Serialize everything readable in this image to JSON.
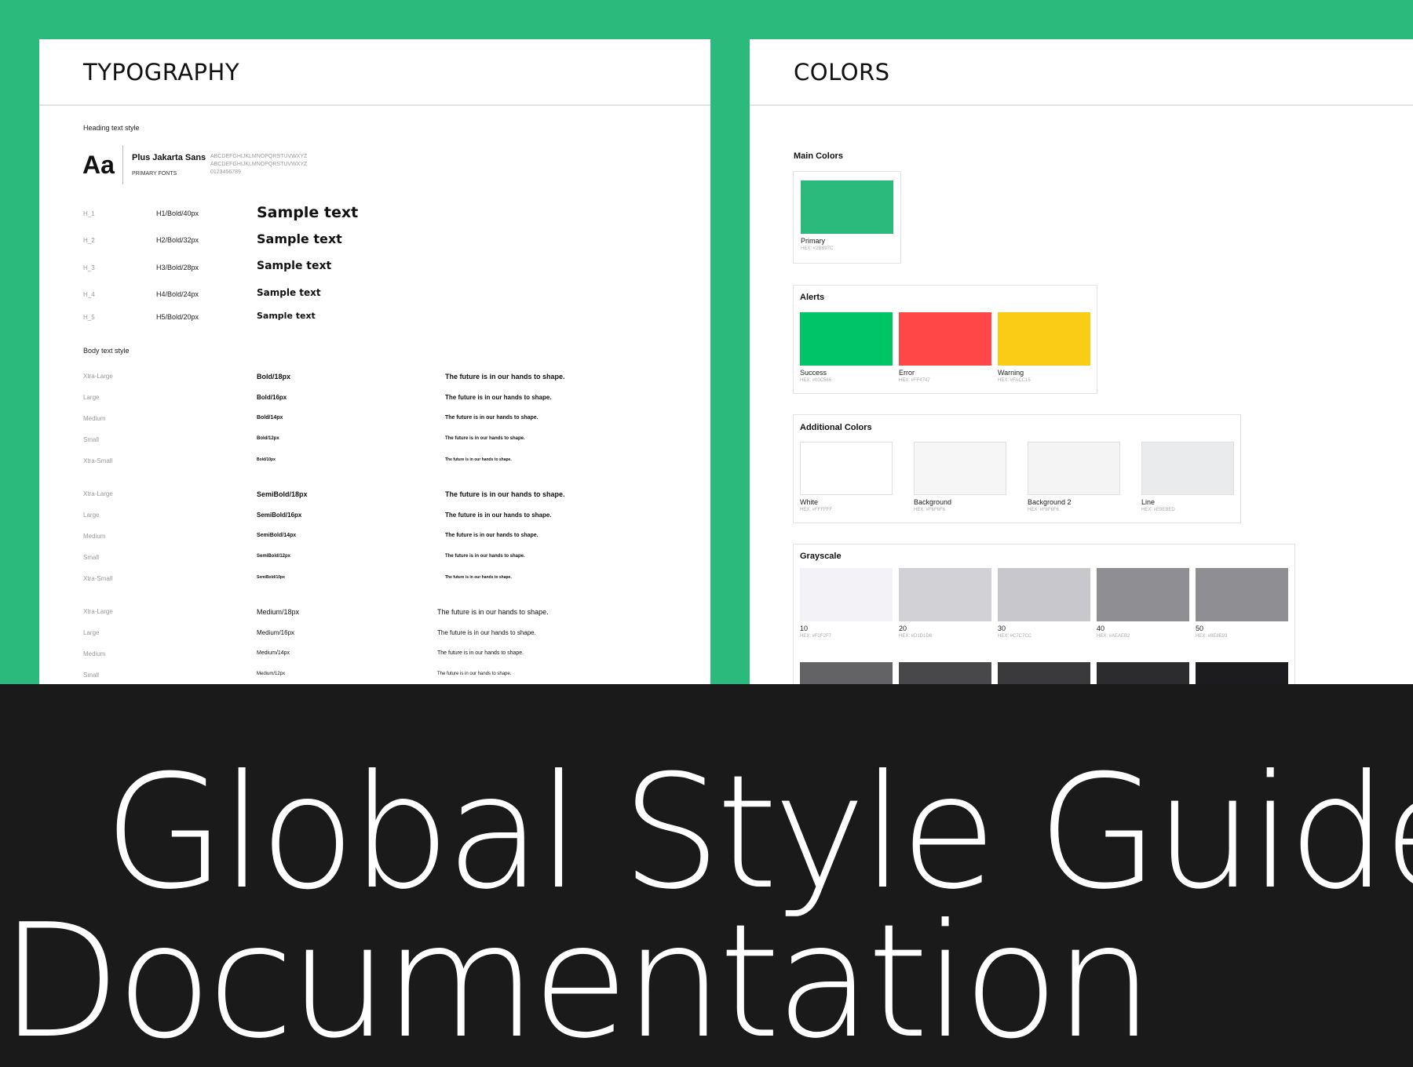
{
  "typography": {
    "title": "TYPOGRAPHY",
    "heading_section_label": "Heading text style",
    "font_sample": "Aa",
    "font_name": "Plus Jakarta Sans",
    "font_role": "PRIMARY FONTS",
    "alphabet_upper": "ABCDEFGHIJKLMNOPQRSTUVWXYZ",
    "alphabet_lower": "ABCDEFGHIJKLMNOPQRSTUVWXYZ",
    "digits": "0123456789",
    "headings": [
      {
        "key": "H_1",
        "spec": "H1/Bold/40px",
        "sample": "Sample text"
      },
      {
        "key": "H_2",
        "spec": "H2/Bold/32px",
        "sample": "Sample text"
      },
      {
        "key": "H_3",
        "spec": "H3/Bold/28px",
        "sample": "Sample text"
      },
      {
        "key": "H_4",
        "spec": "H4/Bold/24px",
        "sample": "Sample text"
      },
      {
        "key": "H_5",
        "spec": "H5/Bold/20px",
        "sample": "Sample text"
      }
    ],
    "body_section_label": "Body text style",
    "body_groups": [
      {
        "rows": [
          {
            "key": "Xtra-Large",
            "spec": "Bold/18px",
            "sample": "The future is in our hands to shape."
          },
          {
            "key": "Large",
            "spec": "Bold/16px",
            "sample": "The future is in our hands to shape."
          },
          {
            "key": "Medium",
            "spec": "Bold/14px",
            "sample": "The future is in our hands to shape."
          },
          {
            "key": "Small",
            "spec": "Bold/12px",
            "sample": "The future is in our hands to shape."
          },
          {
            "key": "Xtra-Small",
            "spec": "Bold/10px",
            "sample": "The future is in our hands to shape."
          }
        ]
      },
      {
        "rows": [
          {
            "key": "Xtra-Large",
            "spec": "SemiBold/18px",
            "sample": "The future is in our hands to shape."
          },
          {
            "key": "Large",
            "spec": "SemiBold/16px",
            "sample": "The future is in our hands to shape."
          },
          {
            "key": "Medium",
            "spec": "SemiBold/14px",
            "sample": "The future is in our hands to shape."
          },
          {
            "key": "Small",
            "spec": "SemiBold/12px",
            "sample": "The future is in our hands to shape."
          },
          {
            "key": "Xtra-Small",
            "spec": "SemiBold/10px",
            "sample": "The future is in our hands to shape."
          }
        ]
      },
      {
        "rows": [
          {
            "key": "Xtra-Large",
            "spec": "Medium/18px",
            "sample": "The future is in our hands to shape."
          },
          {
            "key": "Large",
            "spec": "Medium/16px",
            "sample": "The future is in our hands to shape."
          },
          {
            "key": "Medium",
            "spec": "Medium/14px",
            "sample": "The future is in our hands to shape."
          },
          {
            "key": "Small",
            "spec": "Medium/12px",
            "sample": "The future is in our hands to shape."
          }
        ]
      }
    ]
  },
  "colors": {
    "title": "COLORS",
    "main_label": "Main Colors",
    "main": [
      {
        "name": "Primary",
        "hex_label": "HEX: #2BB97C",
        "color": "#2BB97C"
      }
    ],
    "alerts_label": "Alerts",
    "alerts": [
      {
        "name": "Success",
        "hex_label": "HEX: #00C566",
        "color": "#00C566"
      },
      {
        "name": "Error",
        "hex_label": "HEX: #FF4747",
        "color": "#FF4747"
      },
      {
        "name": "Warning",
        "hex_label": "HEX: #FACC15",
        "color": "#FACC15"
      }
    ],
    "additional_label": "Additional Colors",
    "additional": [
      {
        "name": "White",
        "hex_label": "HEX: #FFFFFF",
        "color": "#FFFFFF"
      },
      {
        "name": "Background",
        "hex_label": "HEX: #F6F6F6",
        "color": "#F6F6F6"
      },
      {
        "name": "Background 2",
        "hex_label": "HEX: #F6F6F6",
        "color": "#F4F4F4"
      },
      {
        "name": "Line",
        "hex_label": "HEX: #E9EBED",
        "color": "#E9EBED"
      }
    ],
    "grayscale_label": "Grayscale",
    "grayscale": [
      {
        "name": "10",
        "hex_label": "HEX: #F2F2F7",
        "color": "#F2F2F7"
      },
      {
        "name": "20",
        "hex_label": "HEX: #D1D1D6",
        "color": "#D1D1D6"
      },
      {
        "name": "30",
        "hex_label": "HEX: #C7C7CC",
        "color": "#C7C7CC"
      },
      {
        "name": "40",
        "hex_label": "HEX: #AEAEB2",
        "color": "#8E8E93"
      },
      {
        "name": "50",
        "hex_label": "HEX: #8E8E93",
        "color": "#8E8E93"
      }
    ],
    "grayscale_dark": [
      {
        "color": "#636366"
      },
      {
        "color": "#48484A"
      },
      {
        "color": "#3A3A3C"
      },
      {
        "color": "#2C2C2E"
      },
      {
        "color": "#1C1C1E"
      }
    ]
  },
  "banner": {
    "line1": "Global Style Guide",
    "line2": "Documentation"
  }
}
